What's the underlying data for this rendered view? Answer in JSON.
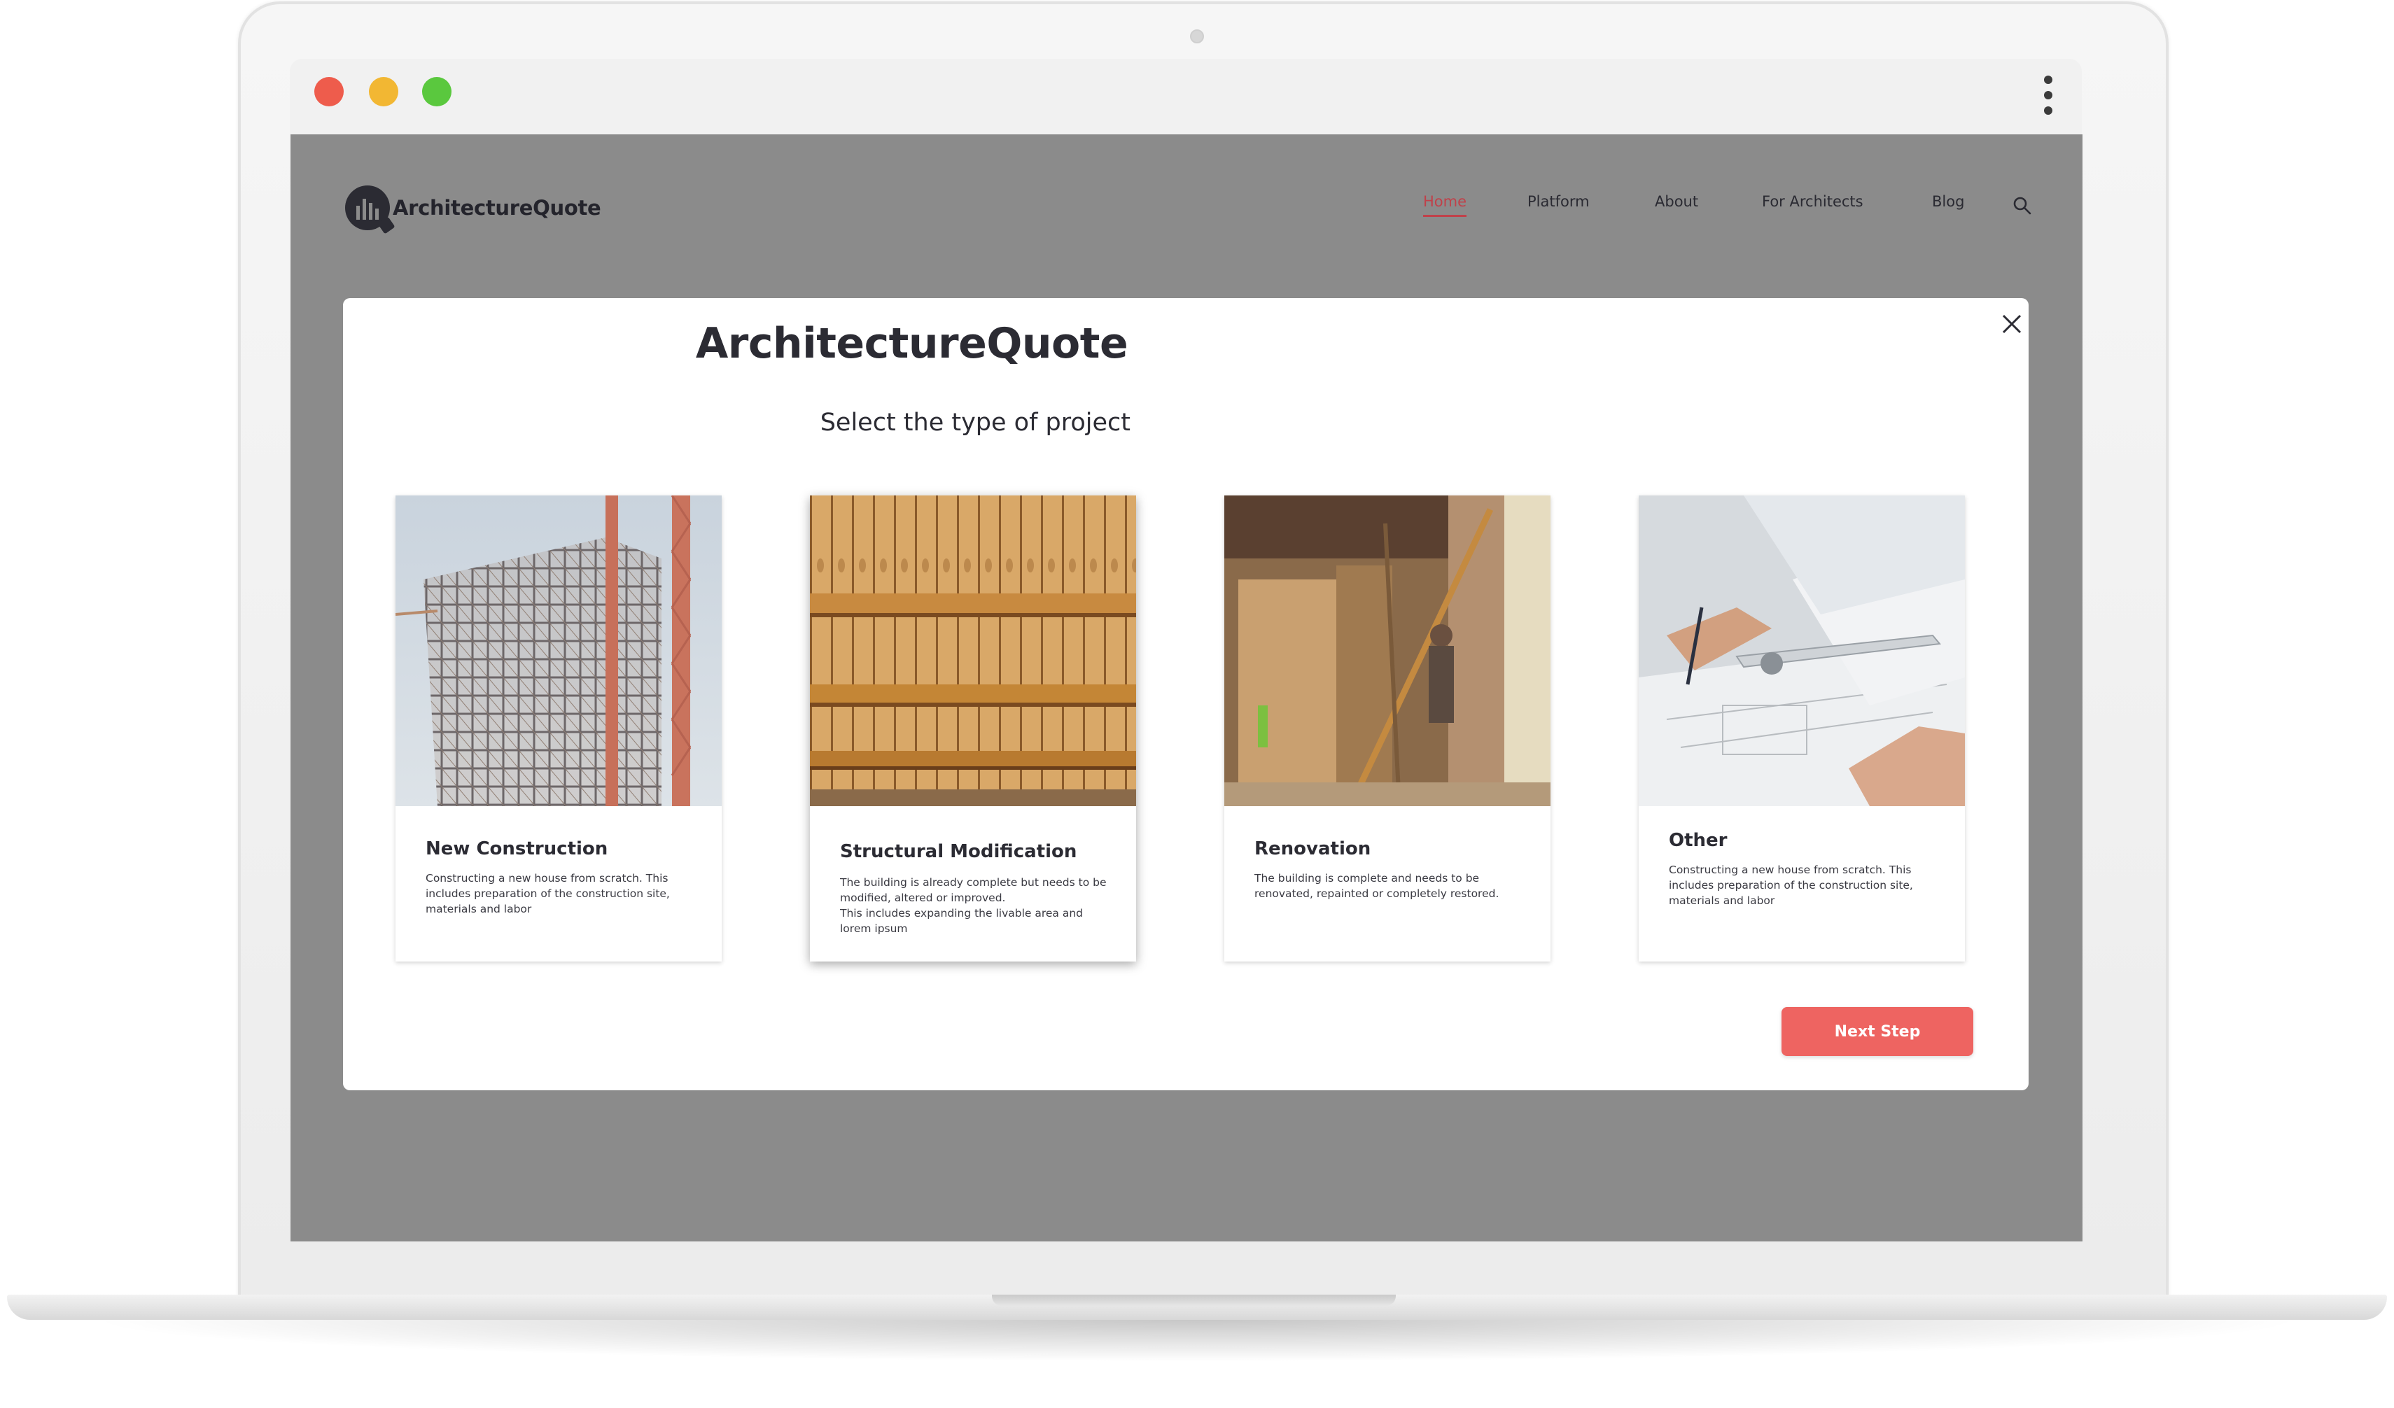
{
  "window": {
    "controls": [
      "close",
      "minimize",
      "maximize"
    ],
    "colors": {
      "close": "#ee5c4c",
      "minimize": "#f2b733",
      "maximize": "#5ac83e"
    },
    "menu_icon": "kebab-menu-icon"
  },
  "header": {
    "logo_text": "ArchitectureQuote",
    "nav": [
      "Home",
      "Platform",
      "About",
      "For Architects",
      "Blog"
    ],
    "active_nav": "Home",
    "search_icon": "search-icon"
  },
  "modal": {
    "title": "ArchitectureQuote",
    "subtitle": "Select the type of project",
    "close_icon": "close-icon",
    "cards": [
      {
        "title": "New Construction",
        "description": "Constructing a new house from scratch. This includes preparation of the construction site, materials and labor",
        "image": "steel-frame-building-under-construction"
      },
      {
        "title": "Structural Modification",
        "description": "The building is already complete but needs to be modified, altered or improved.\nThis includes expanding the livable area and lorem ipsum",
        "image": "wooden-roof-beams",
        "selected": true
      },
      {
        "title": "Renovation",
        "description": "The building is complete and needs to be renovated, repainted or completely restored.",
        "image": "worker-renovating-interior"
      },
      {
        "title": "Other",
        "description": "Constructing a new house from scratch. This includes preparation of the construction site, materials and labor",
        "image": "architect-drawing-plans"
      }
    ],
    "next_button": "Next Step"
  },
  "colors": {
    "accent": "#ee6461",
    "active_nav": "#c0414a",
    "overlay": "#8b8b8b",
    "text_dark": "#2b2b33"
  }
}
